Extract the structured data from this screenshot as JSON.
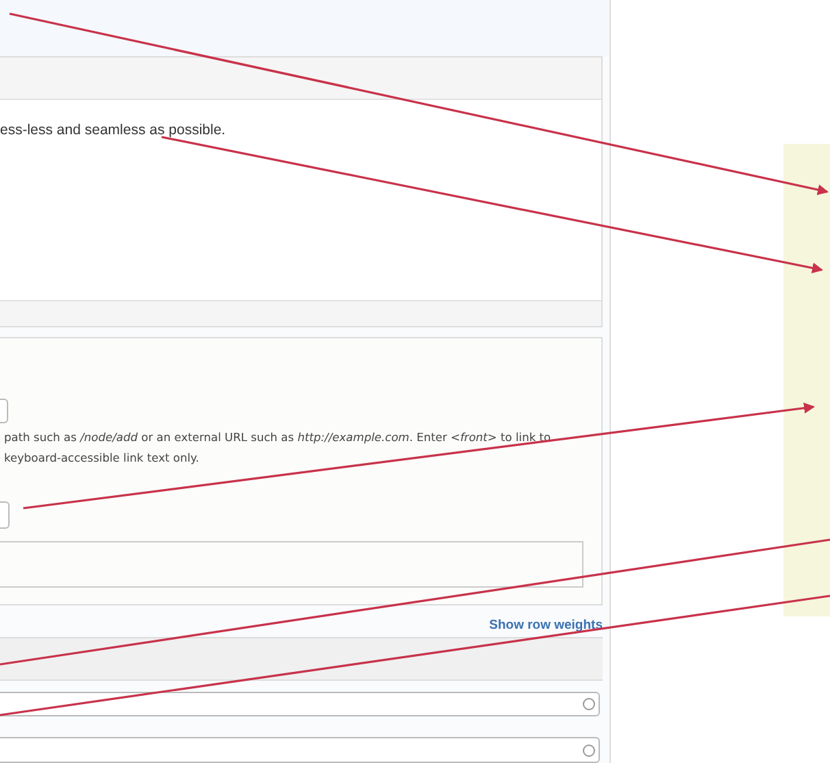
{
  "content_card": {
    "body_text": "ess-less and seamless as possible."
  },
  "link_fieldset": {
    "description_lines": [
      "path such as */node/add* or an external URL such as *http://example.com*. Enter *<front>* to link to",
      "keyboard-accessible link text only."
    ]
  },
  "table_link": "Show row weights"
}
